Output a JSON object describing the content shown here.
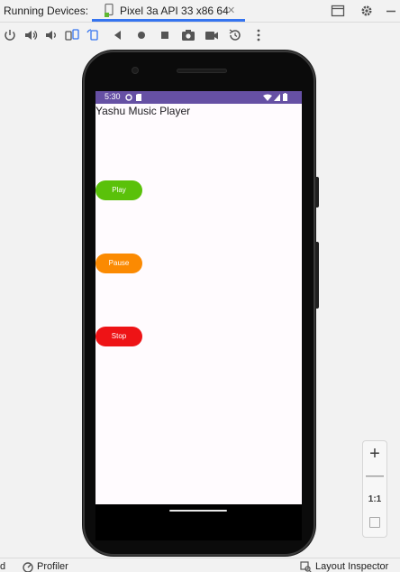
{
  "tabbar": {
    "label": "Running Devices:",
    "device_tab": "Pixel 3a API 33 x86 64",
    "close_glyph": "✕"
  },
  "toolbar": {
    "icons": [
      "power-icon",
      "volume-up-icon",
      "volume-down-icon",
      "rotate-left-icon",
      "rotate-right-icon",
      "back-icon",
      "home-icon",
      "overview-icon",
      "screenshot-icon",
      "screen-record-icon",
      "snapshot-icon",
      "more-icon"
    ]
  },
  "device": {
    "status_time": "5:30",
    "app_title": "Yashu Music Player",
    "buttons": {
      "play": "Play",
      "pause": "Pause",
      "stop": "Stop"
    }
  },
  "zoom": {
    "zoom_in": "+",
    "zoom_out": "—",
    "actual_size": "1:1"
  },
  "bottombar": {
    "left_partial": "d",
    "profiler": "Profiler",
    "layout_inspector": "Layout Inspector"
  },
  "colors": {
    "status_bar": "#6650a4",
    "play": "#5ac10a",
    "pause": "#fb8a02",
    "stop": "#ee1316",
    "tab_underline": "#3574f0"
  }
}
